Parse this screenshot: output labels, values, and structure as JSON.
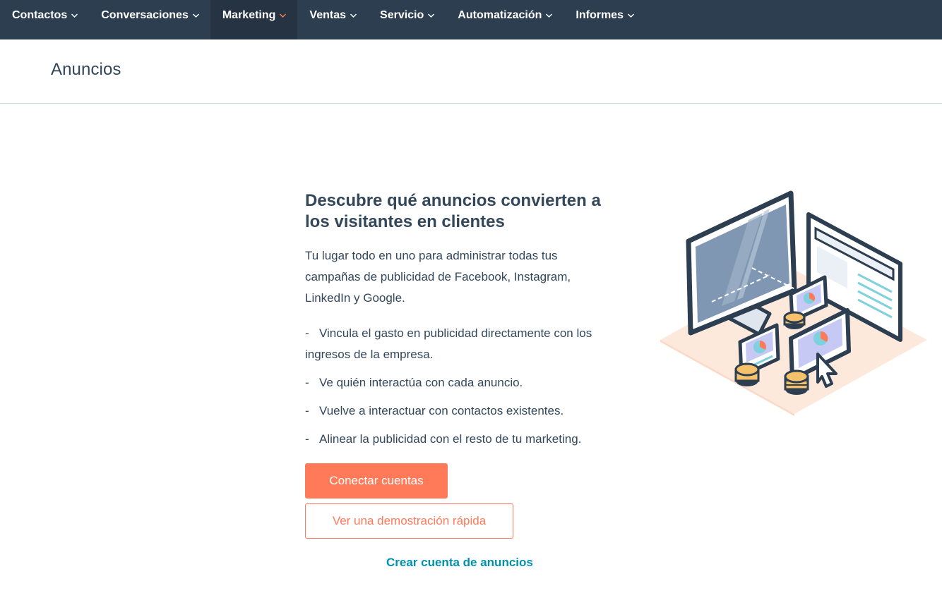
{
  "nav": {
    "items": [
      {
        "label": "Contactos",
        "active": false
      },
      {
        "label": "Conversaciones",
        "active": false
      },
      {
        "label": "Marketing",
        "active": true
      },
      {
        "label": "Ventas",
        "active": false
      },
      {
        "label": "Servicio",
        "active": false
      },
      {
        "label": "Automatización",
        "active": false
      },
      {
        "label": "Informes",
        "active": false
      }
    ],
    "chevron_icon": "chevron-down-icon",
    "background_color": "#2d3e50",
    "active_chevron_color": "#ff7a59"
  },
  "header": {
    "title": "Anuncios"
  },
  "main": {
    "headline": "Descubre qué anuncios convierten a los visitantes en clientes",
    "intro": "Tu lugar todo en uno para administrar todas tus campañas de publicidad de Facebook, Instagram, LinkedIn y Google.",
    "bullets": [
      "Vincula el gasto en publicidad directamente con los ingresos de la empresa.",
      "Ve quién interactúa con cada anuncio.",
      "Vuelve a interactuar con contactos existentes.",
      "Alinear la publicidad con el resto de tu marketing."
    ],
    "bullet_marker": "-",
    "primary_button": "Conectar cuentas",
    "secondary_button": "Ver una demostración rápida",
    "link": "Crear cuenta de anuncios",
    "illustration_icon": "ads-devices-illustration",
    "accent_color": "#ff7a59",
    "link_color": "#0091ae"
  }
}
